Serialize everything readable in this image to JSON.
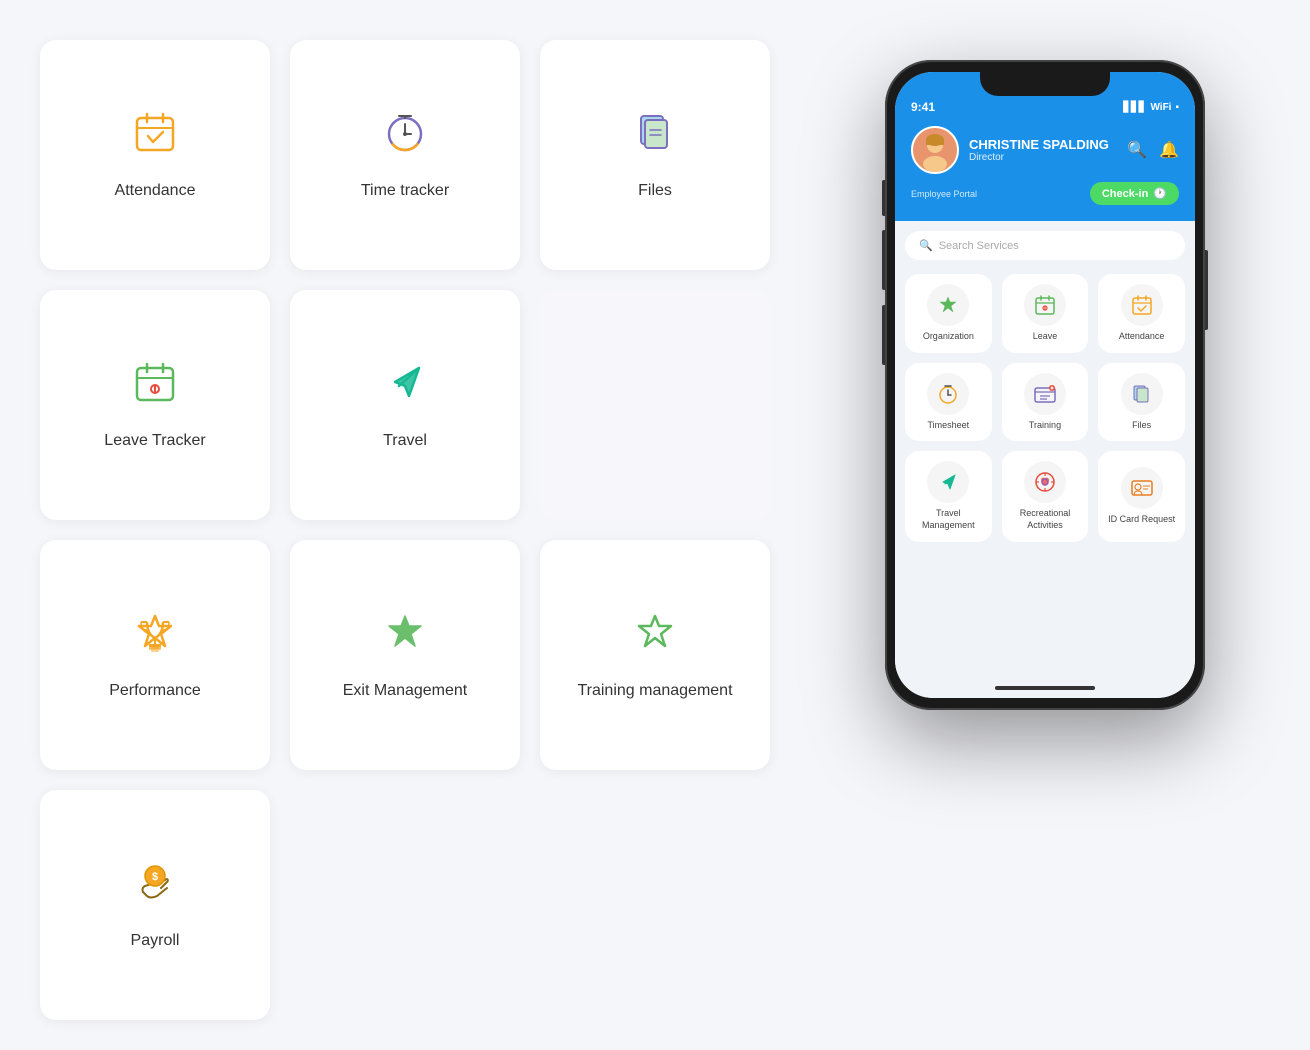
{
  "background": "#f5f6fa",
  "grid": {
    "cards": [
      {
        "id": "attendance",
        "label": "Attendance",
        "icon": "📅",
        "icon_type": "attendance"
      },
      {
        "id": "time-tracker",
        "label": "Time tracker",
        "icon": "⏰",
        "icon_type": "time"
      },
      {
        "id": "files",
        "label": "Files",
        "icon": "📂",
        "icon_type": "files"
      },
      {
        "id": "leave-tracker",
        "label": "Leave Tracker",
        "icon": "📋",
        "icon_type": "leave"
      },
      {
        "id": "travel",
        "label": "Travel",
        "icon": "✈️",
        "icon_type": "travel"
      },
      {
        "id": "performance",
        "label": "Performance",
        "icon": "🏆",
        "icon_type": "performance"
      },
      {
        "id": "exit-management",
        "label": "Exit Management",
        "icon": "⭐",
        "icon_type": "exit"
      },
      {
        "id": "training-management",
        "label": "Training management",
        "icon": "⭐",
        "icon_type": "training"
      },
      {
        "id": "blank1",
        "label": "",
        "icon": "",
        "icon_type": "blank"
      },
      {
        "id": "payroll",
        "label": "Payroll",
        "icon": "💰",
        "icon_type": "payroll"
      }
    ]
  },
  "phone": {
    "status_time": "9:41",
    "user_name": "CHRISTINE SPALDING",
    "user_role": "Director",
    "checkin_label": "Check-in",
    "search_placeholder": "Search Services",
    "app_items": [
      {
        "id": "organization",
        "label": "Organization",
        "icon": "⭐"
      },
      {
        "id": "leave",
        "label": "Leave",
        "icon": "📅"
      },
      {
        "id": "attendance",
        "label": "Attendance",
        "icon": "📋"
      },
      {
        "id": "timesheet",
        "label": "Timesheet",
        "icon": "⏰"
      },
      {
        "id": "training",
        "label": "Training",
        "icon": "📊"
      },
      {
        "id": "files",
        "label": "Files",
        "icon": "📁"
      },
      {
        "id": "travel-management",
        "label": "Travel Management",
        "icon": "✈️"
      },
      {
        "id": "recreational-activities",
        "label": "Recreational Activities",
        "icon": "🎯"
      },
      {
        "id": "id-card-request",
        "label": "ID Card Request",
        "icon": "🏷️"
      }
    ]
  }
}
